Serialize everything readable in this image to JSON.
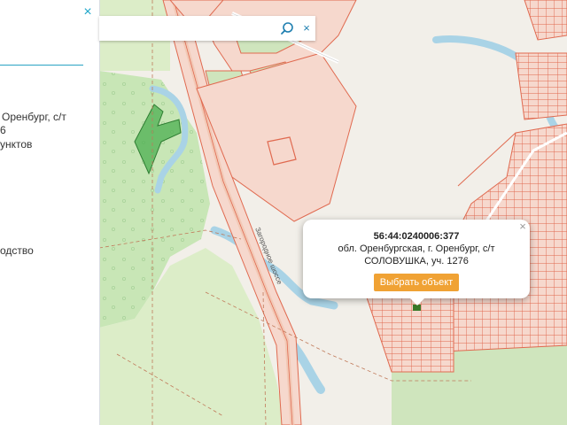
{
  "panel": {
    "close_icon": "×",
    "lines": [
      "Оренбург, с/т",
      "6",
      "унктов",
      "одство"
    ],
    "icons": {
      "close": "close-icon"
    }
  },
  "search": {
    "value": "",
    "placeholder": "",
    "icon": "search-icon",
    "clear_icon": "×"
  },
  "map": {
    "road_label": "Загородное шоссе",
    "colors": {
      "background": "#f2efe9",
      "forest": "#c6e5b4",
      "green_zone": "#d9efc9",
      "parcel_fill": "#f6d3c7",
      "parcel_stroke": "#e06a50",
      "water": "#a9d3e6",
      "selected_parcel": "#4caf50"
    }
  },
  "popup": {
    "cadastral_number": "56:44:0240006:377",
    "address": "обл. Оренбургская, г. Оренбург, с/т СОЛОВУШКА, уч. 1276",
    "button_label": "Выбрать объект",
    "close_icon": "×",
    "button_color": "#f0a234"
  }
}
